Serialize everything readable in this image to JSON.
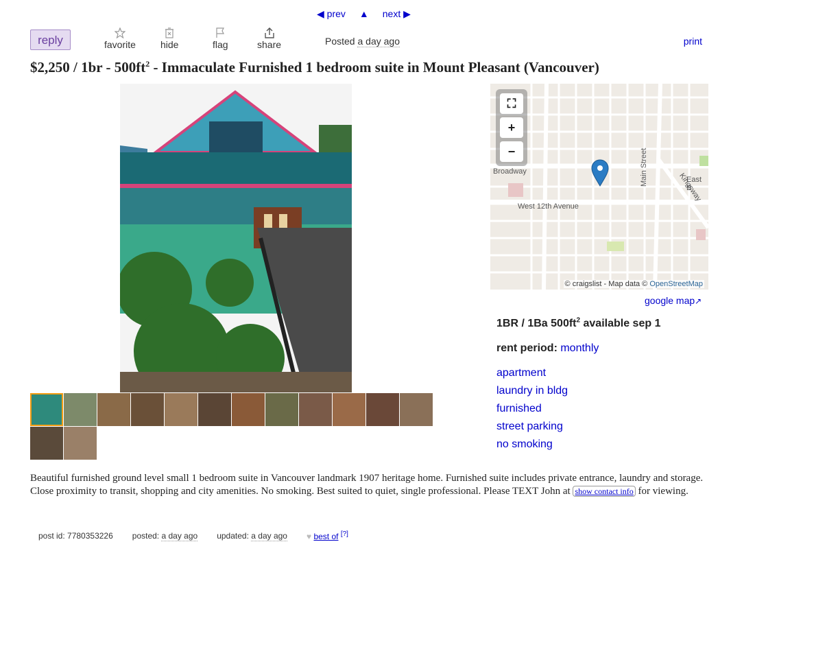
{
  "nav": {
    "prev": "◀ prev",
    "up": "▲",
    "next": "next ▶"
  },
  "toolbar": {
    "reply": "reply",
    "favorite": "favorite",
    "hide": "hide",
    "flag": "flag",
    "share": "share",
    "posted_prefix": "Posted",
    "posted_when": "a day ago",
    "print": "print"
  },
  "title": {
    "price": "$2,250",
    "housing_prefix": " / 1br - 500ft",
    "housing_sup": "2",
    "text": " - Immaculate Furnished 1 bedroom suite in Mount Pleasant",
    "location": " (Vancouver)"
  },
  "gallery": {
    "thumb_count": 14
  },
  "map": {
    "labels": [
      "Broadway",
      "West 12th Avenue",
      "Main Street",
      "Kingsway",
      "East B"
    ],
    "attribution_prefix": "© craigslist - Map data ©",
    "attribution_link": "OpenStreetMap",
    "google_map": "google map"
  },
  "attributes": {
    "summary": "1BR / 1Ba 500ft",
    "summary_sup": "2",
    "available": " available sep 1",
    "rent_label": "rent period:",
    "rent_value": "monthly",
    "items": [
      "apartment",
      "laundry in bldg",
      "furnished",
      "street parking",
      "no smoking"
    ]
  },
  "body": {
    "text": "Beautiful furnished ground level small 1 bedroom suite in Vancouver landmark 1907 heritage home. Furnished suite includes private entrance, laundry and storage. Close proximity to transit, shopping and city amenities. No smoking. Best suited to quiet, single professional. Please TEXT John at ",
    "show_contact": "show contact info",
    "after": " for viewing."
  },
  "footer": {
    "post_id": "post id: 7780353226",
    "posted_label": "posted:",
    "posted_when": "a day ago",
    "updated_label": "updated:",
    "updated_when": "a day ago",
    "best_of": "best of",
    "help": "[?]"
  }
}
